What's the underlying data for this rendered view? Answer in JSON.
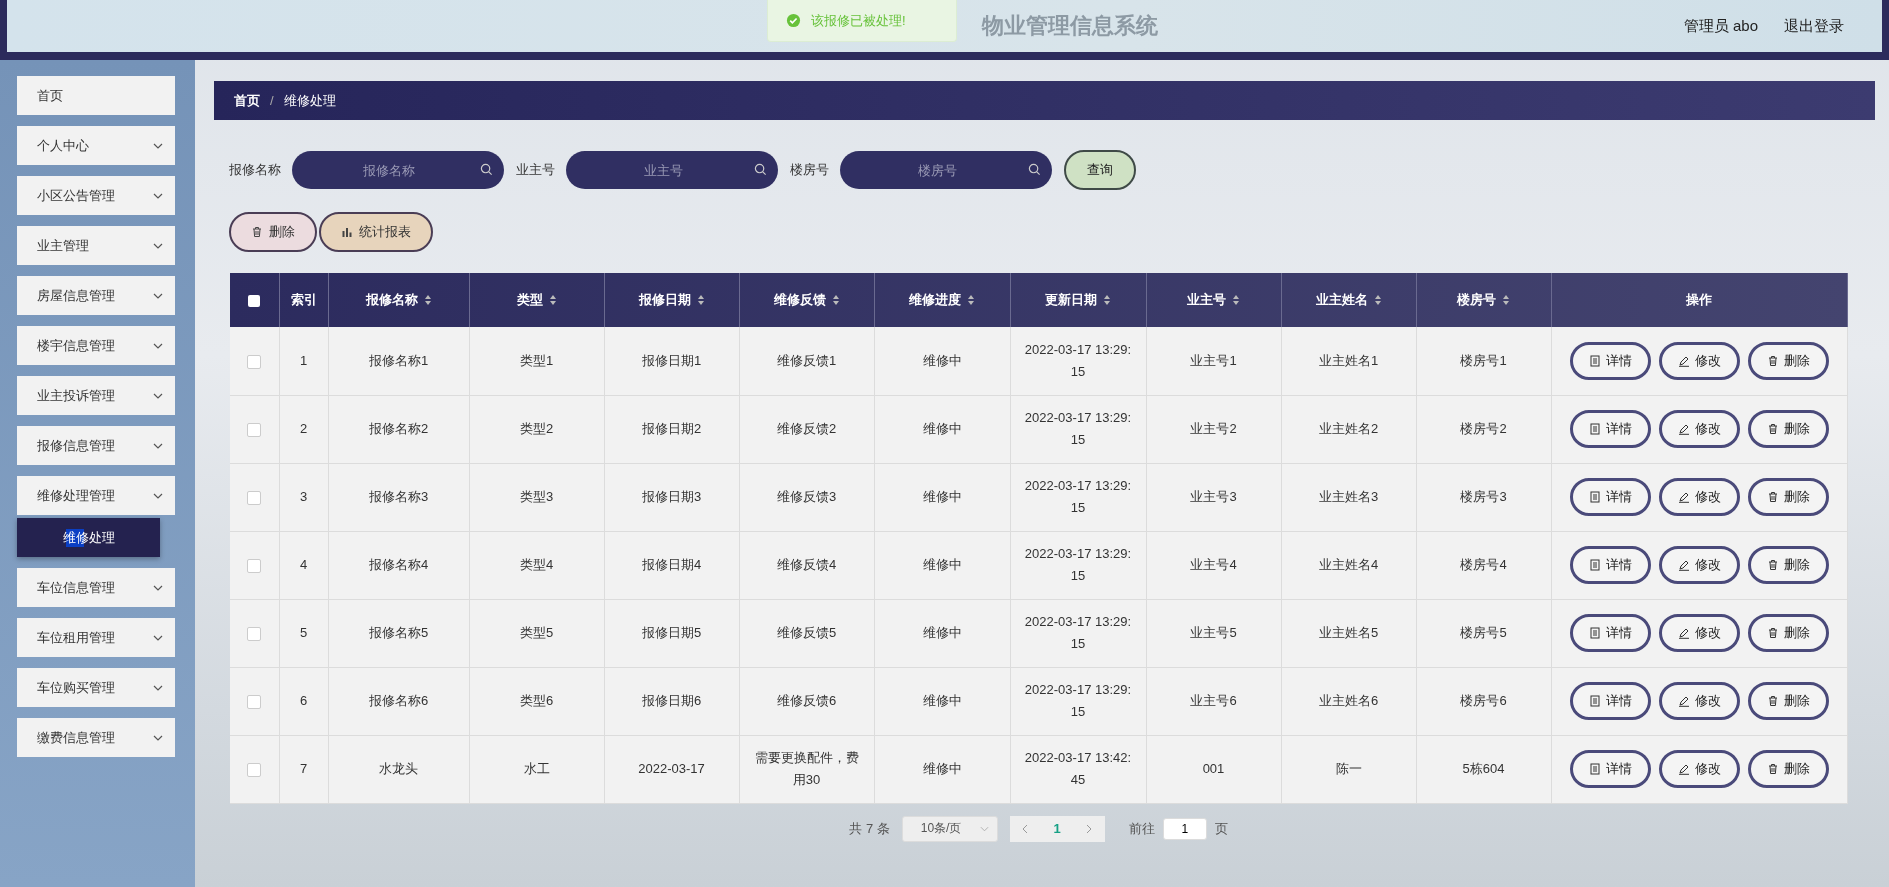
{
  "header": {
    "title": "物业管理信息系统",
    "user": "管理员 abo",
    "logout": "退出登录"
  },
  "toast": {
    "text": "该报修已被处理!"
  },
  "sidebar": {
    "items": [
      {
        "label": "首页",
        "kind": "link"
      },
      {
        "label": "个人中心",
        "kind": "menu"
      },
      {
        "label": "小区公告管理",
        "kind": "menu"
      },
      {
        "label": "业主管理",
        "kind": "menu"
      },
      {
        "label": "房屋信息管理",
        "kind": "menu"
      },
      {
        "label": "楼宇信息管理",
        "kind": "menu"
      },
      {
        "label": "业主投诉管理",
        "kind": "menu"
      },
      {
        "label": "报修信息管理",
        "kind": "menu"
      },
      {
        "label": "维修处理管理",
        "kind": "menu",
        "children": [
          {
            "label": "维修处理",
            "selected": true
          }
        ]
      },
      {
        "label": "车位信息管理",
        "kind": "menu"
      },
      {
        "label": "车位租用管理",
        "kind": "menu"
      },
      {
        "label": "车位购买管理",
        "kind": "menu"
      },
      {
        "label": "缴费信息管理",
        "kind": "menu"
      }
    ]
  },
  "breadcrumb": {
    "items": [
      "首页",
      "维修处理"
    ],
    "separator": "/"
  },
  "search": {
    "fields": [
      {
        "label": "报修名称",
        "placeholder": "报修名称"
      },
      {
        "label": "业主号",
        "placeholder": "业主号"
      },
      {
        "label": "楼房号",
        "placeholder": "楼房号"
      }
    ],
    "button": "查询"
  },
  "actions": [
    {
      "label": "删除",
      "kind": "delete"
    },
    {
      "label": "统计报表",
      "kind": "report"
    }
  ],
  "table": {
    "select_all": {
      "checked": false
    },
    "columns": [
      {
        "label": "索引",
        "sortable": false
      },
      {
        "label": "报修名称",
        "sortable": true
      },
      {
        "label": "类型",
        "sortable": true
      },
      {
        "label": "报修日期",
        "sortable": true
      },
      {
        "label": "维修反馈",
        "sortable": true
      },
      {
        "label": "维修进度",
        "sortable": true
      },
      {
        "label": "更新日期",
        "sortable": true
      },
      {
        "label": "业主号",
        "sortable": true
      },
      {
        "label": "业主姓名",
        "sortable": true
      },
      {
        "label": "楼房号",
        "sortable": true
      },
      {
        "label": "操作",
        "sortable": false
      }
    ],
    "rows": [
      {
        "checked": false,
        "cells": [
          "1",
          "报修名称1",
          "类型1",
          "报修日期1",
          "维修反馈1",
          "维修中",
          "2022-03-17 13:29:15",
          "业主号1",
          "业主姓名1",
          "楼房号1"
        ],
        "actions": [
          "详情",
          "修改",
          "删除"
        ]
      },
      {
        "checked": false,
        "cells": [
          "2",
          "报修名称2",
          "类型2",
          "报修日期2",
          "维修反馈2",
          "维修中",
          "2022-03-17 13:29:15",
          "业主号2",
          "业主姓名2",
          "楼房号2"
        ],
        "actions": [
          "详情",
          "修改",
          "删除"
        ]
      },
      {
        "checked": false,
        "cells": [
          "3",
          "报修名称3",
          "类型3",
          "报修日期3",
          "维修反馈3",
          "维修中",
          "2022-03-17 13:29:15",
          "业主号3",
          "业主姓名3",
          "楼房号3"
        ],
        "actions": [
          "详情",
          "修改",
          "删除"
        ]
      },
      {
        "checked": false,
        "cells": [
          "4",
          "报修名称4",
          "类型4",
          "报修日期4",
          "维修反馈4",
          "维修中",
          "2022-03-17 13:29:15",
          "业主号4",
          "业主姓名4",
          "楼房号4"
        ],
        "actions": [
          "详情",
          "修改",
          "删除"
        ]
      },
      {
        "checked": false,
        "cells": [
          "5",
          "报修名称5",
          "类型5",
          "报修日期5",
          "维修反馈5",
          "维修中",
          "2022-03-17 13:29:15",
          "业主号5",
          "业主姓名5",
          "楼房号5"
        ],
        "actions": [
          "详情",
          "修改",
          "删除"
        ]
      },
      {
        "checked": false,
        "cells": [
          "6",
          "报修名称6",
          "类型6",
          "报修日期6",
          "维修反馈6",
          "维修中",
          "2022-03-17 13:29:15",
          "业主号6",
          "业主姓名6",
          "楼房号6"
        ],
        "actions": [
          "详情",
          "修改",
          "删除"
        ]
      },
      {
        "checked": false,
        "cells": [
          "7",
          "水龙头",
          "水工",
          "2022-03-17",
          "需要更换配件，费用30",
          "维修中",
          "2022-03-17 13:42:45",
          "001",
          "陈一",
          "5栋604"
        ],
        "actions": [
          "详情",
          "修改",
          "删除"
        ]
      }
    ]
  },
  "pagination": {
    "total": "共 7 条",
    "page_size": "10条/页",
    "pages": [
      {
        "label": "1",
        "selected": true
      }
    ],
    "goto_label": "前往",
    "goto_value": "1",
    "goto_unit": "页"
  }
}
